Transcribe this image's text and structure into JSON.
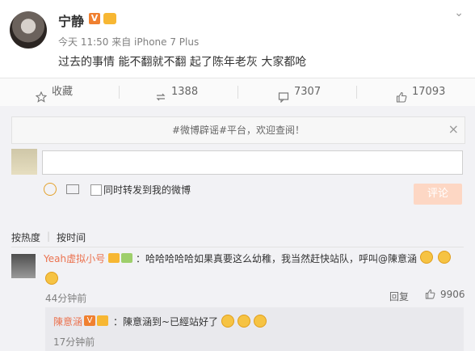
{
  "post": {
    "username": "宁静",
    "verified_badge": "V",
    "meta": "今天 11:50 来自 iPhone 7 Plus",
    "text": "过去的事情 能不翻就不翻 起了陈年老灰 大家都呛"
  },
  "actions": {
    "favorite": "收藏",
    "repost": "1388",
    "comment": "7307",
    "like": "17093"
  },
  "comment_box": {
    "notice": "#微博辟谣#平台，欢迎查阅！",
    "sync_label": "同时转发到我的微博",
    "submit_label": "评论"
  },
  "tabs": [
    "按热度",
    "按时间"
  ],
  "comments": [
    {
      "name": "Yeah虚拟小号",
      "text": "：哈哈哈哈哈如果真要这么幼稚，我当然赶快站队，呼叫@陳意涵",
      "time": "44分钟前",
      "reply_label": "回复",
      "likes": "9906"
    }
  ],
  "sub_reply": {
    "name": "陳意涵",
    "badge": "V",
    "text": "：陳意涵到~已經站好了",
    "time": "17分钟前"
  },
  "colors": {
    "accent": "#eb7350",
    "verified": "#f08030",
    "panel": "#f2f2f5"
  }
}
